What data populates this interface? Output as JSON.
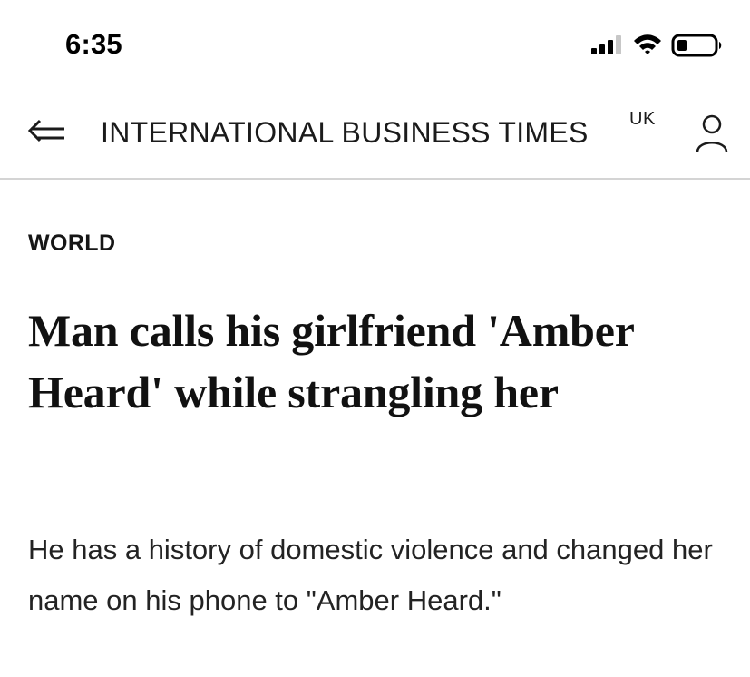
{
  "status_bar": {
    "time": "6:35",
    "icons": [
      "signal-icon",
      "wifi-icon",
      "battery-icon"
    ]
  },
  "header": {
    "back_icon": "back-arrow-icon",
    "publication": "INTERNATIONAL BUSINESS TIMES",
    "edition": "UK",
    "account_icon": "user-icon"
  },
  "article": {
    "section": "WORLD",
    "headline": "Man calls his girlfriend 'Amber Heard' while strangling her",
    "summary": "He has a history of domestic violence and changed her name on his phone to \"Amber Heard.\""
  },
  "colors": {
    "background": "#ffffff",
    "text": "#111111",
    "divider": "#d4d4d4"
  }
}
